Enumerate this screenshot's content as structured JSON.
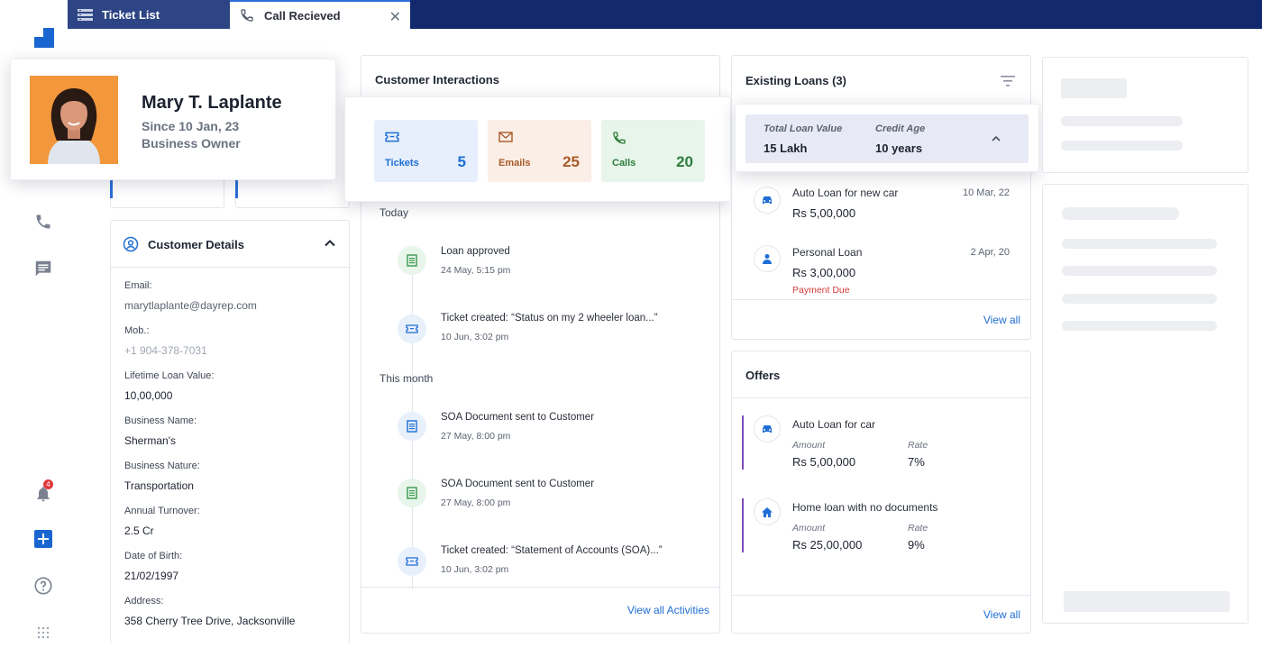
{
  "tabs": [
    {
      "label": "Ticket List",
      "icon": "list-icon"
    },
    {
      "label": "Call Recieved",
      "icon": "phone-icon"
    }
  ],
  "rail": {
    "notification_count": "4"
  },
  "profile": {
    "name": "Mary T. Laplante",
    "since": "Since 10 Jan, 23",
    "role": "Business Owner"
  },
  "customer_details": {
    "title": "Customer Details",
    "fields": [
      {
        "label": "Email:",
        "value": "marytlaplante@dayrep.com"
      },
      {
        "label": "Mob.:",
        "value": "+1 904-378-7031"
      },
      {
        "label": "Lifetime Loan Value:",
        "value": "10,00,000"
      },
      {
        "label": "Business Name:",
        "value": "Sherman's"
      },
      {
        "label": "Business Nature:",
        "value": "Transportation"
      },
      {
        "label": "Annual Turnover:",
        "value": "2.5 Cr"
      },
      {
        "label": "Date of Birth:",
        "value": "21/02/1997"
      },
      {
        "label": "Address:",
        "value": "358 Cherry Tree Drive, Jacksonville"
      }
    ]
  },
  "interactions": {
    "title": "Customer Interactions",
    "stats": [
      {
        "label": "Tickets",
        "value": "5",
        "color": "#1f6ed4",
        "bg": "#e6effb",
        "icon": "ticket-icon"
      },
      {
        "label": "Emails",
        "value": "25",
        "color": "#a85a2a",
        "bg": "#fbeee6",
        "icon": "mail-icon"
      },
      {
        "label": "Calls",
        "value": "20",
        "color": "#2e7d3a",
        "bg": "#e7f5ea",
        "icon": "phone-icon"
      }
    ],
    "today_label": "Today",
    "month_label": "This month",
    "today": [
      {
        "title": "Loan approved",
        "time": "24 May, 5:15 pm",
        "kind": "doc-green"
      },
      {
        "title": "Ticket created: “Status on my 2 wheeler loan...”",
        "time": "10 Jun, 3:02 pm",
        "kind": "ticket"
      }
    ],
    "month": [
      {
        "title": "SOA Document sent to Customer",
        "time": "27 May, 8:00 pm",
        "kind": "doc-blue"
      },
      {
        "title": "SOA Document sent to Customer",
        "time": "27 May, 8:00 pm",
        "kind": "doc-green"
      },
      {
        "title": "Ticket created: “Statement of Accounts (SOA)...”",
        "time": "10 Jun, 3:02 pm",
        "kind": "ticket"
      }
    ],
    "view_all": "View all Activities"
  },
  "loans": {
    "title": "Existing Loans (3)",
    "summary": {
      "total_label": "Total Loan Value",
      "total_value": "15 Lakh",
      "age_label": "Credit Age",
      "age_value": "10 years"
    },
    "items": [
      {
        "name": "Auto Loan for new car",
        "amount": "Rs 5,00,000",
        "date": "10 Mar, 22",
        "icon": "car-icon"
      },
      {
        "name": "Personal Loan",
        "amount": "Rs 3,00,000",
        "date": "2 Apr, 20",
        "due": "Payment Due",
        "icon": "person-icon"
      }
    ],
    "view_all": "View all"
  },
  "offers": {
    "title": "Offers",
    "items": [
      {
        "name": "Auto Loan for car",
        "amount_label": "Amount",
        "amount": "Rs 5,00,000",
        "rate_label": "Rate",
        "rate": "7%",
        "icon": "car-icon"
      },
      {
        "name": "Home loan with no documents",
        "amount_label": "Amount",
        "amount": "Rs 25,00,000",
        "rate_label": "Rate",
        "rate": "9%",
        "icon": "home-icon"
      }
    ],
    "view_all": "View all"
  }
}
